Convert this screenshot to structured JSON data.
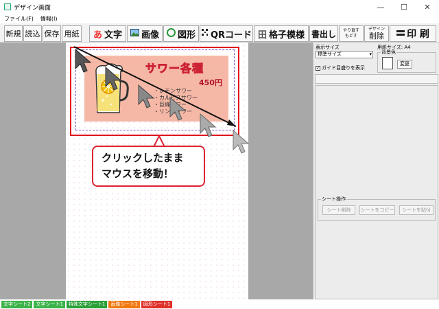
{
  "window": {
    "title": "デザイン画面",
    "controls": [
      "—",
      "☐",
      "✕"
    ]
  },
  "menu": [
    "ファイル(F)",
    "情報(I)"
  ],
  "toolbar": {
    "new": "新規",
    "read": "読込",
    "save": "保存",
    "paper": "用紙",
    "text": "文字",
    "image": "画像",
    "shape": "図形",
    "qr": "QRコード",
    "grid": "格子模様",
    "export": "書出し",
    "redo_top": "やり直す",
    "redo_bottom": "もどす",
    "del_top": "デザイン",
    "del_bottom": "削除",
    "print": "印 刷",
    "icons": {
      "text": "あ",
      "grid": "田"
    }
  },
  "design": {
    "title": "サワー各種",
    "price": "450円",
    "items": [
      "・レモンサワー",
      "・カルピスサワー",
      "・巨峰サワー",
      "・リンゴサワー"
    ]
  },
  "callout": {
    "line1": "クリックしたまま",
    "line2": "マウスを移動！"
  },
  "side": {
    "display_size_label": "表示サイズ",
    "display_size_value": "標準サイズ",
    "paper_size_label": "用紙サイズ: A4",
    "bg_color_label": "背景色",
    "change_button": "変更",
    "guide_checkbox": "ガイド目盛りを表示",
    "sheet_ops_label": "シート操作",
    "sheet_delete": "シート削除",
    "sheet_copy": "シートをコピー",
    "sheet_paste": "シートを貼付"
  },
  "statusbar": [
    {
      "label": "文字シート2",
      "color": "#3cb34a"
    },
    {
      "label": "文字シート1",
      "color": "#3cb34a"
    },
    {
      "label": "特殊文字シート1",
      "color": "#2aa038"
    },
    {
      "label": "画像シート1",
      "color": "#f07a10"
    },
    {
      "label": "図形シート1",
      "color": "#e0302a"
    }
  ],
  "colors": {
    "accent": "#e0101c",
    "design_bg": "#f6b8a6"
  }
}
